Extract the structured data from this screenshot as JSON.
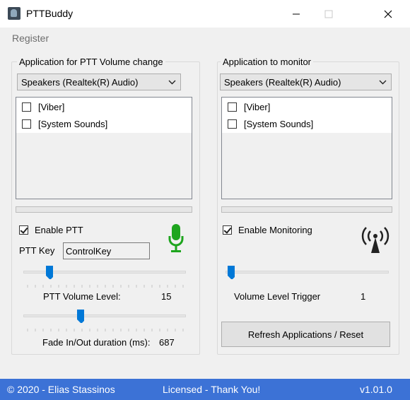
{
  "window": {
    "title": "PTTBuddy",
    "icon": "headset-app-icon"
  },
  "menu": {
    "register": "Register"
  },
  "left_group": {
    "title": "Application for PTT Volume change",
    "device": "Speakers (Realtek(R) Audio)",
    "apps": [
      {
        "label": "[Viber]",
        "checked": false
      },
      {
        "label": "[System Sounds]",
        "checked": false
      }
    ],
    "level_progress": 0,
    "enable_label": "Enable PTT",
    "enable_checked": true,
    "ptt_key_label": "PTT Key",
    "ptt_key_value": "ControlKey",
    "mic_icon_color": "#1ea51e",
    "volume_label": "PTT Volume Level:",
    "volume_value": "15",
    "fade_label": "Fade In/Out duration (ms):",
    "fade_value": "687"
  },
  "right_group": {
    "title": "Application to monitor",
    "device": "Speakers (Realtek(R) Audio)",
    "apps": [
      {
        "label": "[Viber]",
        "checked": false
      },
      {
        "label": "[System Sounds]",
        "checked": false
      }
    ],
    "level_progress": 0,
    "enable_label": "Enable Monitoring",
    "enable_checked": true,
    "trigger_label": "Volume Level Trigger",
    "trigger_value": "1",
    "refresh_label": "Refresh Applications / Reset"
  },
  "status": {
    "copyright": "© 2020 - Elias Stassinos",
    "license": "Licensed - Thank You!",
    "version": "v1.01.0",
    "background": "#3c72d6"
  },
  "colors": {
    "accent": "#0078d7",
    "progress": "#06b025"
  }
}
